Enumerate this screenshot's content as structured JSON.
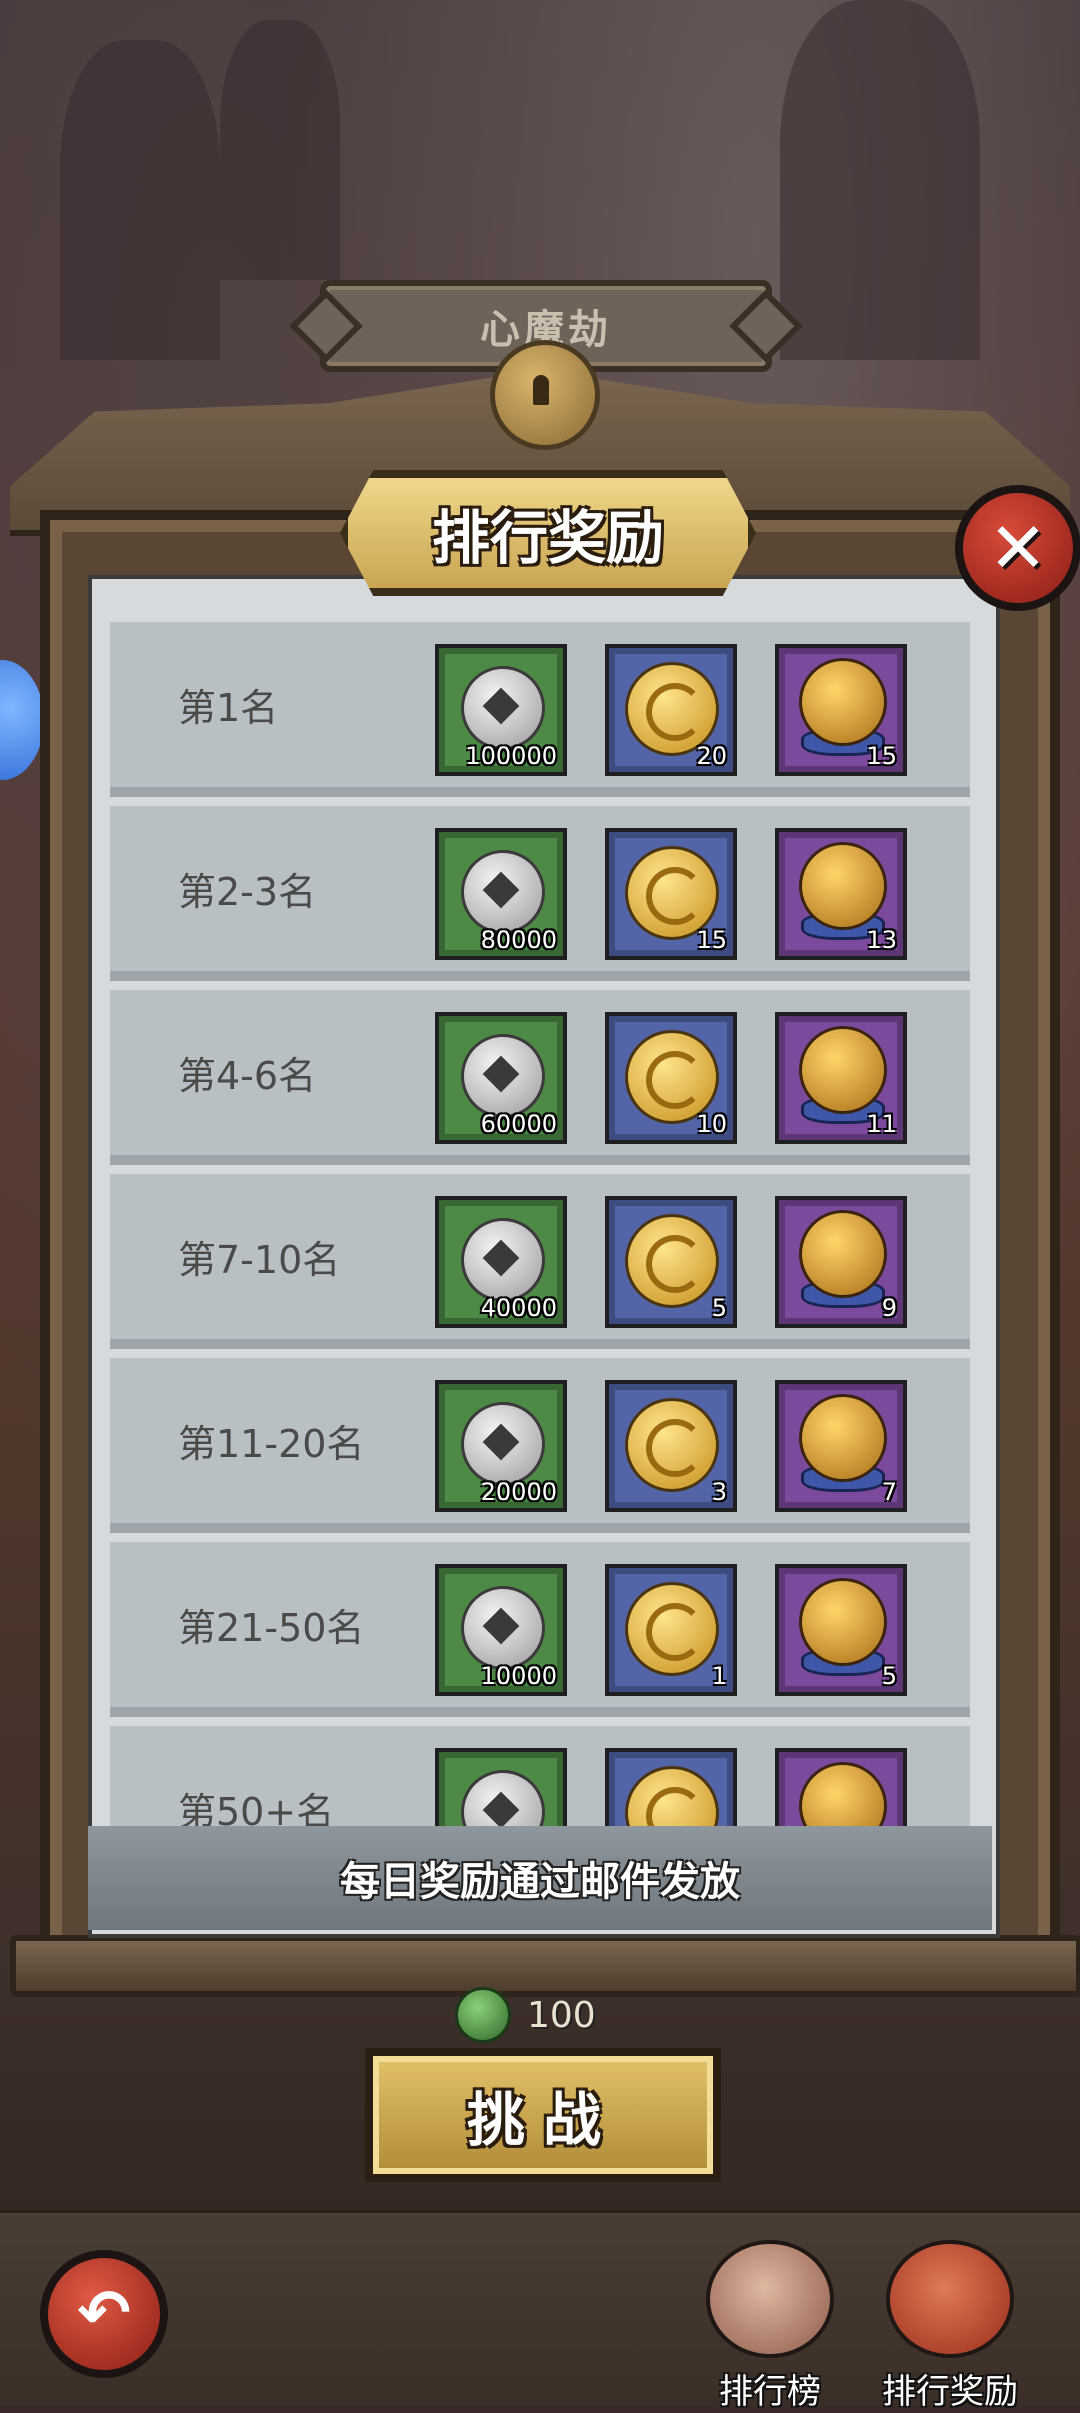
{
  "top_label": "心魔劫",
  "dialog": {
    "title": "排行奖励",
    "close_label": "✕",
    "rows": [
      {
        "rank": "第1名",
        "items": [
          "100000",
          "20",
          "15"
        ]
      },
      {
        "rank": "第2-3名",
        "items": [
          "80000",
          "15",
          "13"
        ]
      },
      {
        "rank": "第4-6名",
        "items": [
          "60000",
          "10",
          "11"
        ]
      },
      {
        "rank": "第7-10名",
        "items": [
          "40000",
          "5",
          "9"
        ]
      },
      {
        "rank": "第11-20名",
        "items": [
          "20000",
          "3",
          "7"
        ]
      },
      {
        "rank": "第21-50名",
        "items": [
          "10000",
          "1",
          "5"
        ]
      },
      {
        "rank": "第50+名",
        "items": [
          "",
          "",
          ""
        ]
      }
    ],
    "notice": "每日奖励通过邮件发放"
  },
  "cost": {
    "value": "100",
    "icon": "green-token-icon"
  },
  "challenge_button": "挑战",
  "back_button_icon": "↶",
  "nav": {
    "leaderboard_label": "排行榜",
    "rewards_label": "排行奖励"
  }
}
